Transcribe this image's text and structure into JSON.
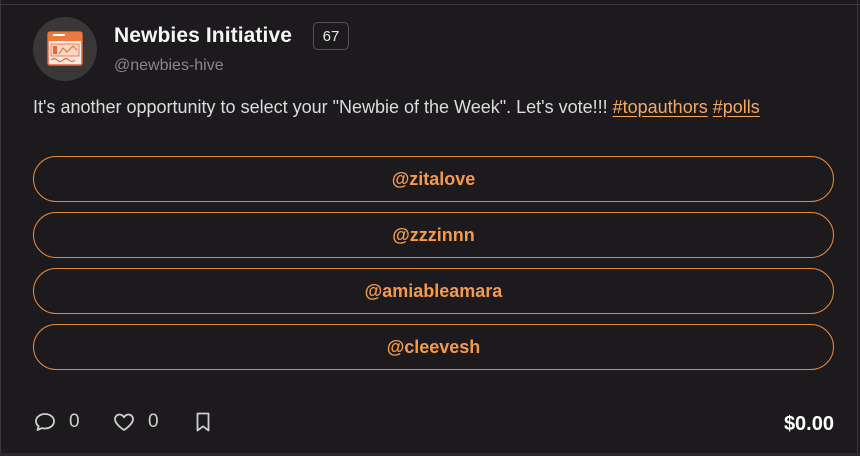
{
  "author": {
    "name": "Newbies Initiative",
    "reputation": "67",
    "handle": "@newbies-hive",
    "avatar_icon": "hello-name-tag-icon"
  },
  "post": {
    "text": "It's another opportunity to select your \"Newbie of the Week\". Let's vote!!! ",
    "tags": [
      "#topauthors",
      "#polls"
    ]
  },
  "poll": {
    "options": [
      "@zitalove",
      "@zzzinnn",
      "@amiableamara",
      "@cleevesh"
    ]
  },
  "footer": {
    "comments_count": "0",
    "likes_count": "0",
    "payout": "$0.00"
  },
  "colors": {
    "accent": "#e58a3c",
    "background": "#1c1a1d"
  }
}
